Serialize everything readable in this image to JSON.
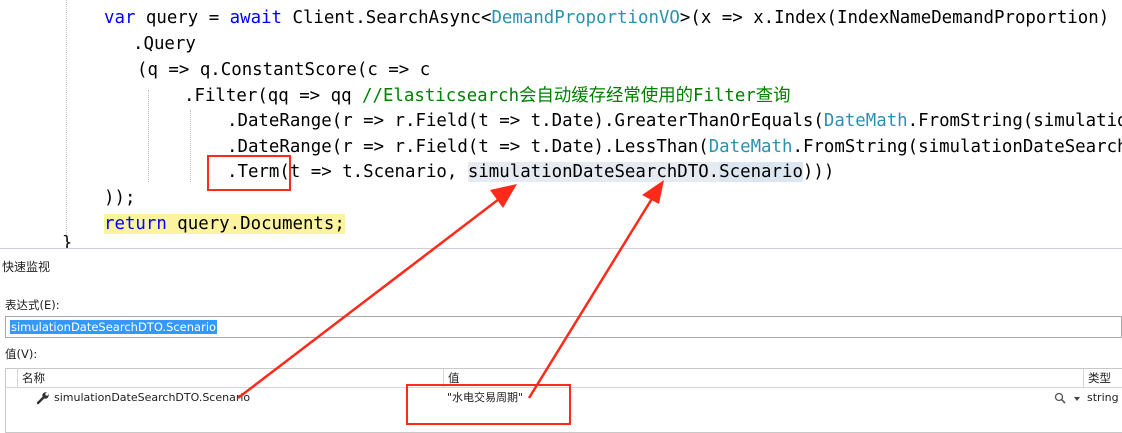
{
  "editor": {
    "line1": {
      "kw_var": "var",
      "t1": " query = ",
      "kw_await": "await",
      "t2": " Client.",
      "m1": "SearchAsync",
      "t3": "<",
      "ty1": "DemandProportionVO",
      "t4": ">(x => x.",
      "m2": "Index",
      "t5": "(IndexNameDemandProportion)"
    },
    "line2": {
      "t1": ".",
      "m1": "Query"
    },
    "line3": {
      "t1": "(q => q.",
      "m1": "ConstantScore",
      "t2": "(c => c"
    },
    "line4": {
      "t1": ".",
      "m1": "Filter",
      "t2": "(qq => qq ",
      "comment": "//Elasticsearch会自动缓存经常使用的Filter查询"
    },
    "line5": {
      "t1": ".",
      "m1": "DateRange",
      "t2": "(r => r.",
      "m2": "Field",
      "t3": "(t => t.",
      "m3": "Date",
      "t4": ").",
      "m4": "GreaterThanOrEquals",
      "t5": "(",
      "ty1": "DateMath",
      "t6": ".",
      "m5": "FromString",
      "t7": "(simulatio"
    },
    "line6": {
      "t1": ".",
      "m1": "DateRange",
      "t2": "(r => r.",
      "m2": "Field",
      "t3": "(t => t.",
      "m3": "Date",
      "t4": ").",
      "m4": "LessThan",
      "t5": "(",
      "ty1": "DateMath",
      "t6": ".",
      "m5": "FromString",
      "t7": "(simulationDateSearch"
    },
    "line7": {
      "t1": ".",
      "m1": "Term",
      "t2": "(t => t.",
      "m2": "Scenario",
      "t3": ", ",
      "ref": "simulationDateSearchDTO",
      "t4": ".",
      "ref2": "Scenario",
      "t5": ")))"
    },
    "line8": {
      "t1": "));"
    },
    "line9": {
      "kw_return": "return",
      "t1": " query.",
      "m1": "Documents",
      "t2": ";"
    },
    "brace": "}"
  },
  "quick_watch": {
    "title": "快速监视",
    "expression_label": "表达式(E):",
    "expression_value": "simulationDateSearchDTO.Scenario",
    "value_label": "值(V):",
    "columns": {
      "name": "名称",
      "value": "值",
      "type": "类型"
    },
    "row": {
      "name": "simulationDateSearchDTO.Scenario",
      "value": "\"水电交易周期\"",
      "type": "string"
    }
  },
  "colors": {
    "keyword": "#0000ff",
    "type": "#2b91af",
    "comment": "#008000",
    "annotation": "#ff2a1a",
    "selection": "#3399ff",
    "current_line": "#fcf3a0"
  },
  "icons": [
    "wrench-icon",
    "magnifier-icon",
    "dropdown-arrow-icon"
  ]
}
